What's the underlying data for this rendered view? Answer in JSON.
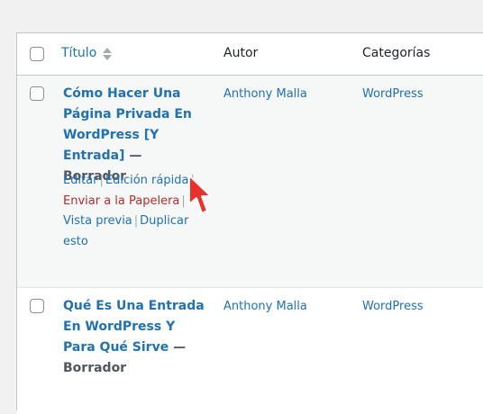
{
  "header": {
    "title_label": "Título",
    "author_label": "Autor",
    "categories_label": "Categorías"
  },
  "rows": [
    {
      "title": "Cómo Hacer Una Página Privada En WordPress [Y Entrada]",
      "state": "— Borrador",
      "author": "Anthony Malla",
      "category": "WordPress",
      "actions": {
        "edit": "Editar",
        "quick_edit": "Edición rápida",
        "trash": "Enviar a la Papelera",
        "preview": "Vista previa",
        "duplicate": "Duplicar esto"
      }
    },
    {
      "title": "Qué Es Una Entrada En WordPress Y Para Qué Sirve",
      "state": "— Borrador",
      "author": "Anthony Malla",
      "category": "WordPress"
    }
  ],
  "separator": "|",
  "colors": {
    "link": "#2271b1",
    "trash": "#b32d2e",
    "cursor": "#e8322a"
  },
  "icons": {
    "sort": "sort-arrows-icon",
    "cursor": "mouse-pointer-icon"
  }
}
